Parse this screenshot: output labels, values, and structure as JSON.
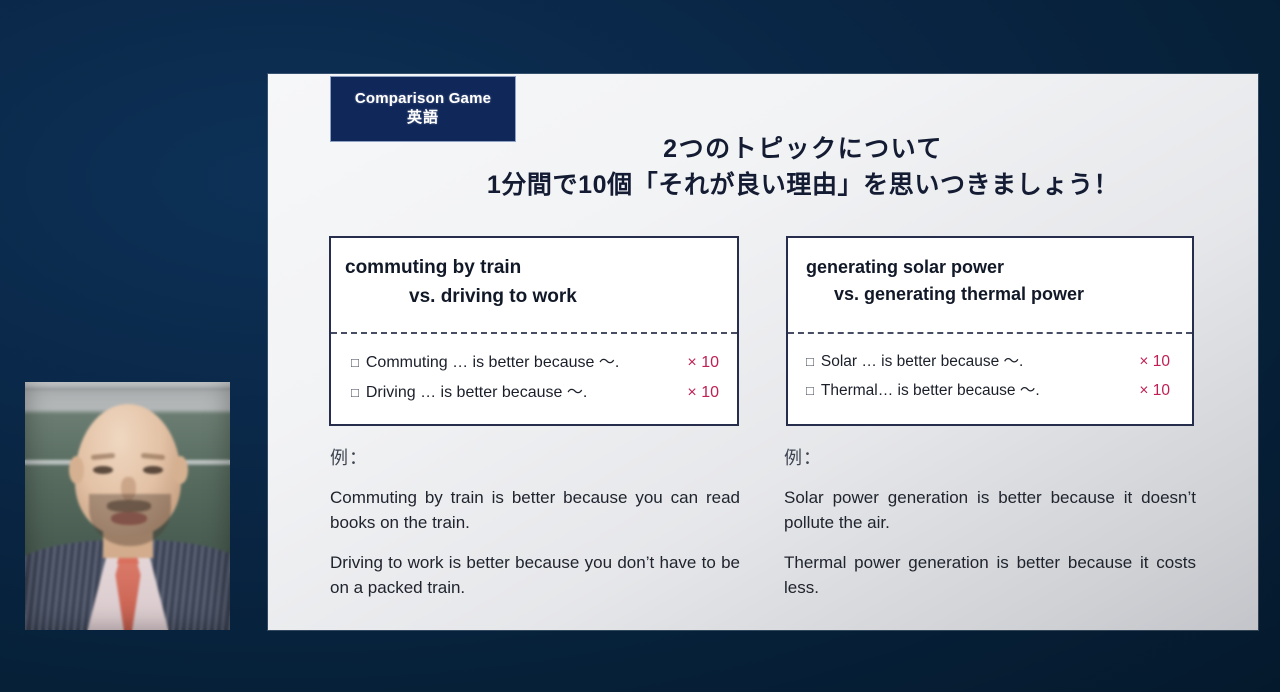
{
  "badge": {
    "title": "Comparison Game",
    "subject": "英語"
  },
  "heading": {
    "line1": "2つのトピックについて",
    "line2": "1分間で10個「それが良い理由」を思いつきましょう！"
  },
  "colors": {
    "background": "#0a2747",
    "badge_bg": "#10275a",
    "box_border": "#272e4d",
    "multiplier": "#bf1f52",
    "heading_text": "#141c33"
  },
  "boxes": [
    {
      "topic_a": "commuting by train",
      "topic_vs": "vs.  driving to work",
      "items": [
        {
          "checkbox": "□",
          "text": "Commuting … is better because 〜.",
          "multiplier": "× 10"
        },
        {
          "checkbox": "□",
          "text": "Driving … is better because 〜.",
          "multiplier": "× 10"
        }
      ]
    },
    {
      "topic_a": "generating solar power",
      "topic_vs": "vs.  generating thermal power",
      "items": [
        {
          "checkbox": "□",
          "text": "Solar … is better because 〜.",
          "multiplier": "× 10"
        },
        {
          "checkbox": "□",
          "text": "Thermal… is better because 〜.",
          "multiplier": "× 10"
        }
      ]
    }
  ],
  "examples": [
    {
      "label": "例：",
      "sentence1": "Commuting by train is better because you can read books on the train.",
      "sentence2": "Driving to work is better because you don’t have to be on a packed train."
    },
    {
      "label": "例：",
      "sentence1": "Solar power generation is better because it doesn’t pollute the air.",
      "sentence2": "Thermal power generation is better because it costs less."
    }
  ]
}
